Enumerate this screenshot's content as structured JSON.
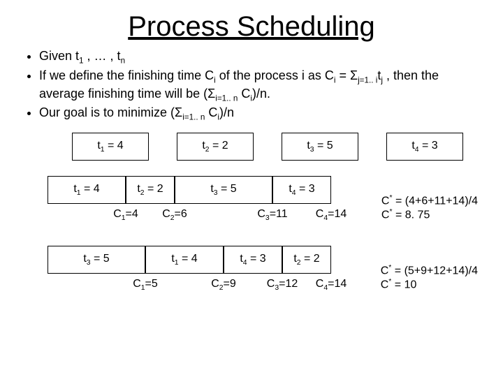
{
  "title": "Process Scheduling",
  "bullets": {
    "b1_pre": "Given t",
    "b1_mid": " , … , t",
    "b2_a": "If we define the finishing time C",
    "b2_b": " of the process i as C",
    "b2_c": " = Σ",
    "b2_d": "t",
    "b2_e": " , then the average finishing time will be  (Σ",
    "b2_f": " C",
    "b2_g": ")/n.",
    "b3_a": "Our goal is to minimize (Σ",
    "b3_b": " C",
    "b3_c": ")/n",
    "sub1": "1",
    "subn": "n",
    "subi": "i",
    "subj": "j",
    "sub_j1i": "j=1.. i",
    "sub_i1n": "i=1.. n"
  },
  "row1": {
    "t1": "t",
    "t1s": "1",
    "t1eq": " = 4",
    "t2": "t",
    "t2s": "2",
    "t2eq": " = 2",
    "t3": "t",
    "t3s": "3",
    "t3eq": " = 5",
    "t4": "t",
    "t4s": "4",
    "t4eq": " = 3"
  },
  "schedA": {
    "seg1": {
      "pre": "t",
      "sub": "1",
      "eq": " = 4"
    },
    "seg2": {
      "pre": "t",
      "sub": "2",
      "eq": " = 2"
    },
    "seg3": {
      "pre": "t",
      "sub": "3",
      "eq": " = 5"
    },
    "seg4": {
      "pre": "t",
      "sub": "4",
      "eq": " = 3"
    },
    "c1": {
      "pre": "C",
      "sub": "1",
      "eq": "=4"
    },
    "c2": {
      "pre": "C",
      "sub": "2",
      "eq": "=6"
    },
    "c3": {
      "pre": "C",
      "sub": "3",
      "eq": "=11"
    },
    "c4": {
      "pre": "C",
      "sub": "4",
      "eq": "=14"
    },
    "res1_a": "C",
    "res1_star": "*",
    "res1_b": " = (4+6+11+14)/4",
    "res2_a": "C",
    "res2_star": "*",
    "res2_b": " = 8. 75"
  },
  "schedB": {
    "seg1": {
      "pre": "t",
      "sub": "3",
      "eq": " = 5"
    },
    "seg2": {
      "pre": "t",
      "sub": "1",
      "eq": " = 4"
    },
    "seg3": {
      "pre": "t",
      "sub": "4",
      "eq": " = 3"
    },
    "seg4": {
      "pre": "t",
      "sub": "2",
      "eq": " = 2"
    },
    "c1": {
      "pre": "C",
      "sub": "1",
      "eq": "=5"
    },
    "c2": {
      "pre": "C",
      "sub": "2",
      "eq": "=9"
    },
    "c3": {
      "pre": "C",
      "sub": "3",
      "eq": "=12"
    },
    "c4": {
      "pre": "C",
      "sub": "4",
      "eq": "=14"
    },
    "res1_a": "C",
    "res1_star": "*",
    "res1_b": " = (5+9+12+14)/4",
    "res2_a": "C",
    "res2_star": "*",
    "res2_b": " = 10"
  },
  "chart_data": {
    "type": "bar",
    "title": "Process durations and cumulative finishing times",
    "tasks": {
      "t1": 4,
      "t2": 2,
      "t3": 5,
      "t4": 3
    },
    "schedules": [
      {
        "order": [
          "t1",
          "t2",
          "t3",
          "t4"
        ],
        "C": [
          4,
          6,
          11,
          14
        ],
        "C_star": 8.75
      },
      {
        "order": [
          "t3",
          "t1",
          "t4",
          "t2"
        ],
        "C": [
          5,
          9,
          12,
          14
        ],
        "C_star": 10
      }
    ]
  }
}
